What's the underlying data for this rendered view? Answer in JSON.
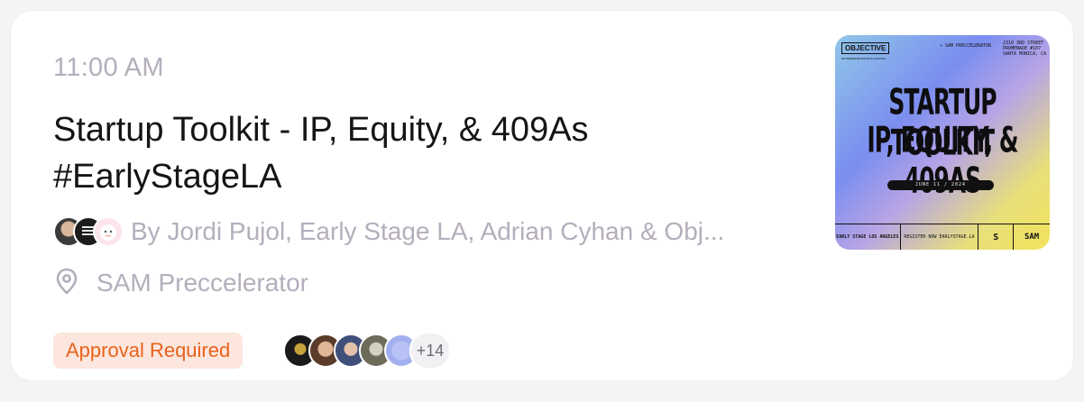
{
  "event": {
    "time": "11:00 AM",
    "title": "Startup Toolkit - IP, Equity, & 409As #EarlyStageLA",
    "hosts_text": "By Jordi Pujol, Early Stage LA, Adrian Cyhan & Obj...",
    "location": "SAM Preccelerator",
    "approval_badge": "Approval Required",
    "guest_count_more": "+14"
  },
  "cover": {
    "tag": "OBJECTIVE",
    "tag_sub": "ENTREPRENEURSHIP & FINANCE",
    "host": "✳ SAM PRECCELERATOR",
    "address": "2310 3RD STREET PROMENADE #107 SANTA MONICA, CA",
    "headline_1": "STARTUP TOOLKIT",
    "headline_2": "IP, EQUITY, & 409AS",
    "date": "JUNE 11 / 2024",
    "footer_early": "EARLY STAGE LOS ANGELES",
    "footer_register": "REGISTER NOW EARLYSTAGE.LA",
    "footer_s": "S",
    "footer_sam": "SAM"
  },
  "colors": {
    "muted_text": "#b5aebc",
    "title_text": "#131517",
    "badge_bg": "#fde6dd",
    "badge_text": "#e8631c"
  },
  "icons": {
    "location": "map-pin-icon"
  }
}
